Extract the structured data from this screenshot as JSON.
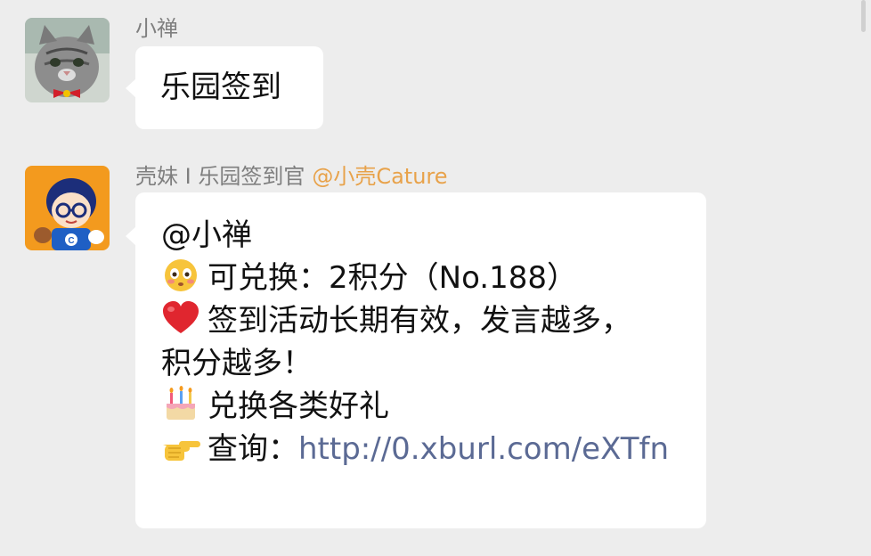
{
  "messages": [
    {
      "sender": "小禅",
      "text": "乐园签到"
    },
    {
      "sender": "壳妹 I 乐园签到官",
      "sender_tag": "@小壳Cature",
      "lines": {
        "mention": "@小禅",
        "points": "可兑换：2积分（No.188）",
        "tip_a": "签到活动长期有效，发言越多，",
        "tip_b": "积分越多！",
        "gifts": "兑换各类好礼",
        "query_label": "查询：",
        "query_link": "http://0.xburl.com/eXTfn"
      }
    }
  ],
  "colors": {
    "background": "#ededed",
    "bubble": "#ffffff",
    "sender_name": "#7f7f7f",
    "sender_tag": "#e8a24a",
    "link": "#5b6a94"
  },
  "icons": {
    "points": "flushed-face-emoji",
    "tip": "red-heart-emoji",
    "gifts": "birthday-cake-emoji",
    "query": "pointing-right-emoji"
  }
}
